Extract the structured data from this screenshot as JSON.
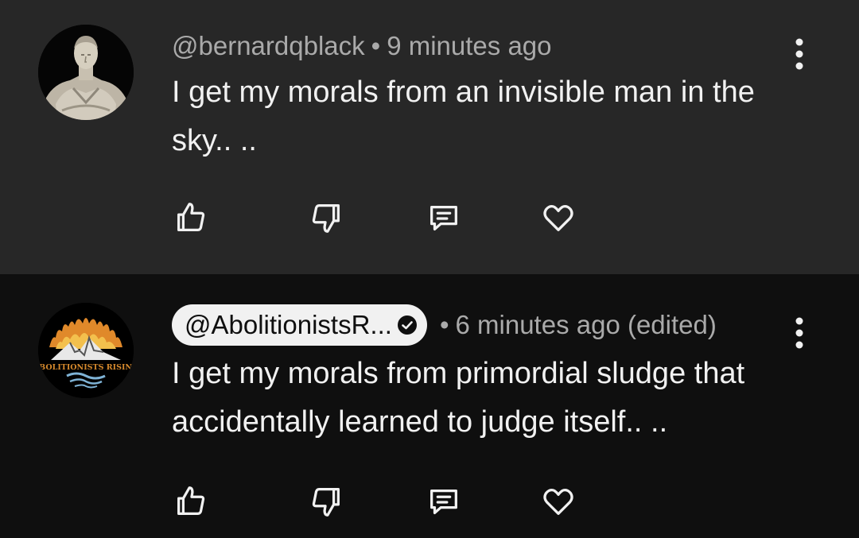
{
  "comments": [
    {
      "author": "@bernardqblack",
      "time": "9 minutes ago",
      "text": "I get my morals from an invisible man in the sky.. ..",
      "avatar_icon": "roman-bust-avatar"
    },
    {
      "author": "@AbolitionistsR...",
      "time": "6 minutes ago (edited)",
      "text": "I get my morals from primordial sludge that accidentally learned to judge itself.. ..",
      "avatar_icon": "abolitionists-rising-logo",
      "avatar_logo_text": "ABOLITIONISTS RISING",
      "verified": true
    }
  ],
  "icons": {
    "like": "thumbs-up-icon",
    "dislike": "thumbs-down-icon",
    "reply": "comment-icon",
    "heart": "heart-icon",
    "menu": "more-vertical-icon"
  },
  "colors": {
    "bg_highlight": "#272727",
    "bg_default": "#0f0f0f",
    "text": "#f1f1f1",
    "meta": "#aaaaaa"
  }
}
